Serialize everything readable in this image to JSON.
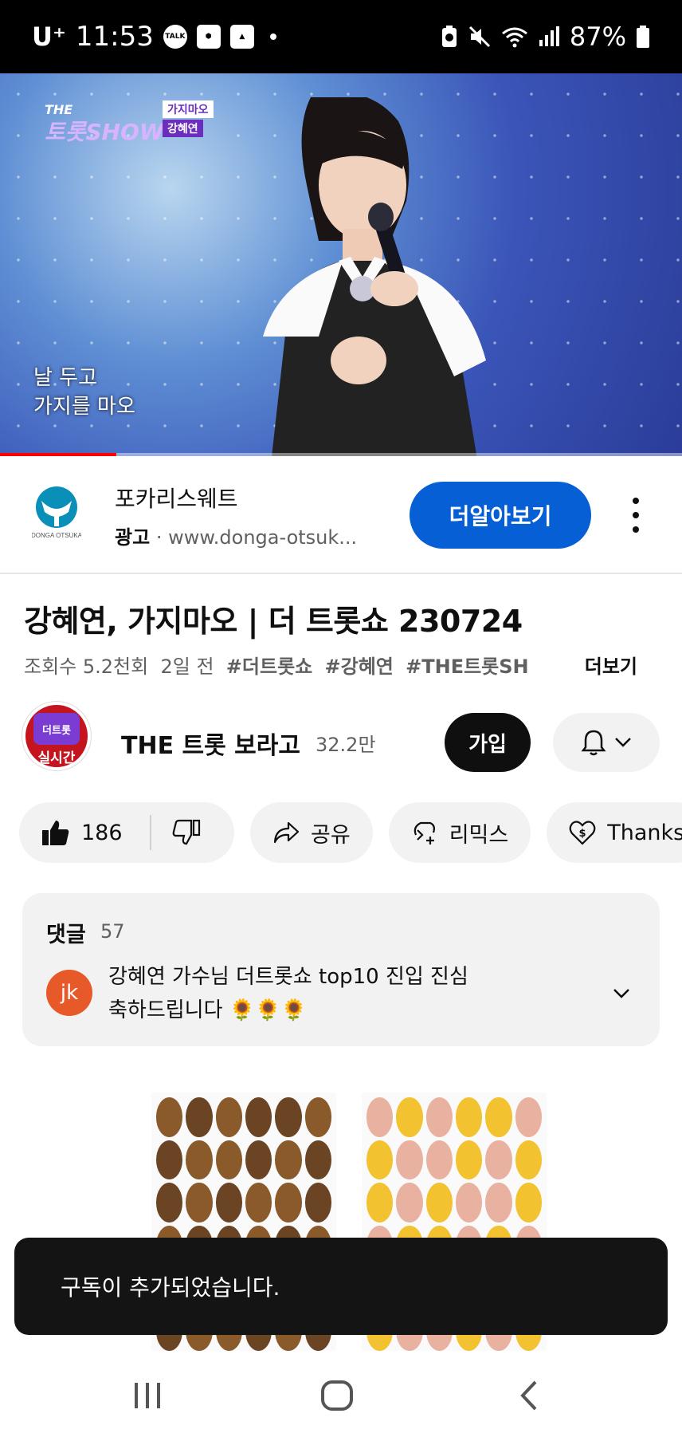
{
  "status_bar": {
    "carrier": "U⁺",
    "time": "11:53",
    "talk_icon_label": "TALK",
    "battery": "87%",
    "icons": [
      "talk-icon",
      "cube-icon",
      "gallery-icon",
      "dot-icon",
      "battery-saver-icon",
      "mute-icon",
      "wifi-icon",
      "signal-icon",
      "battery-icon"
    ]
  },
  "video": {
    "show_logo_top": "THE",
    "show_logo_main": "트롯SHOW",
    "song_tag": "가지마오",
    "singer_tag": "강혜연",
    "lyrics_line1": "날 두고",
    "lyrics_line2": "가지를 마오",
    "progress": 0.17
  },
  "ad": {
    "name": "포카리스웨트",
    "label": "광고",
    "separator": "·",
    "url": "www.donga-otsuk...",
    "cta": "더알아보기",
    "logo_text": "DONGA OTSUKA"
  },
  "video_info": {
    "title": "강혜연, 가지마오 | 더 트롯쇼 230724",
    "views": "조회수 5.2천회",
    "age": "2일 전",
    "tags": [
      "#더트롯쇼",
      "#강혜연",
      "#THE트롯SH"
    ],
    "more": "더보기"
  },
  "channel": {
    "avatar_top": "더트롯",
    "avatar_badge": "실시간",
    "name": "THE 트롯 보라고",
    "subscribers": "32.2만",
    "join": "가입"
  },
  "actions": {
    "likes": "186",
    "share": "공유",
    "remix": "리믹스",
    "thanks": "Thanks"
  },
  "comments": {
    "heading": "댓글",
    "count": "57",
    "author_initials": "jk",
    "text_line1": "강혜연 가수님 더트롯쇼 top10 진입 진심",
    "text_line2": "축하드립니다 🌻🌻🌻"
  },
  "toast": {
    "message": "구독이 추가되었습니다."
  },
  "colors": {
    "brand_blue": "#065fd4",
    "progress_red": "#ff0000",
    "chip_bg": "#f2f2f2"
  }
}
